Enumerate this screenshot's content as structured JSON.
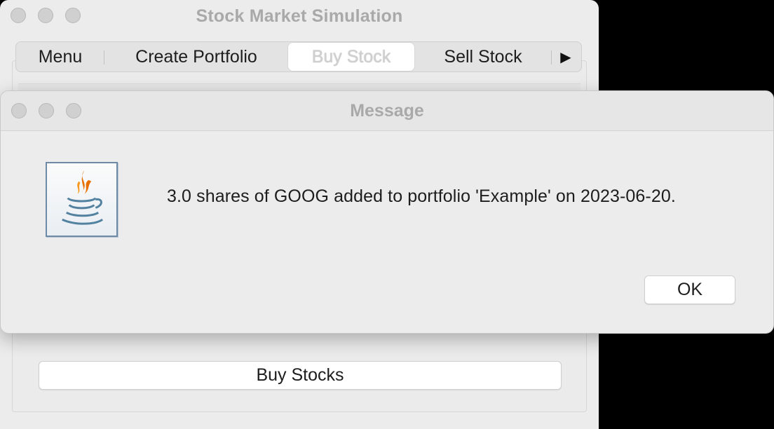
{
  "main_window": {
    "title": "Stock Market Simulation",
    "tabs": [
      {
        "label": "Menu"
      },
      {
        "label": "Create Portfolio"
      },
      {
        "label": "Buy Stock"
      },
      {
        "label": "Sell Stock"
      }
    ],
    "active_tab": "Buy Stock",
    "tab_overflow_icon": "right-triangle-icon",
    "buy_stocks_button": "Buy Stocks"
  },
  "dialog": {
    "title": "Message",
    "icon": "java-icon",
    "message": "3.0 shares of GOOG added to portfolio 'Example' on 2023-06-20.",
    "ok_label": "OK"
  },
  "colors": {
    "title_text": "#a9a9a9",
    "window_bg": "#ececec",
    "java_flame_orange": "#e76f00",
    "java_cup_blue": "#5382a1"
  }
}
